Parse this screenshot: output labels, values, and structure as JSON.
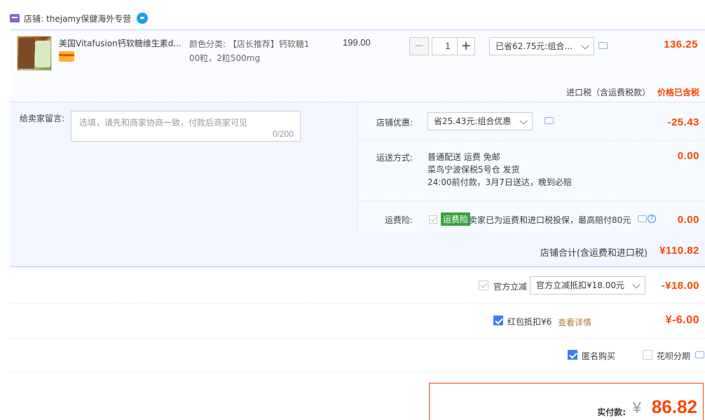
{
  "store": {
    "prefix": "店铺:",
    "name": "thejamy保健海外专营"
  },
  "item": {
    "title": "美国Vitafusion钙软糖维生素d...",
    "sku_line1": "颜色分类: 【店长推荐】钙软糖1",
    "sku_line2": "00粒，2粒500mg",
    "unit_price": "199.00",
    "quantity": "1",
    "qty_minus": "−",
    "qty_plus": "+",
    "promo_selected": "已省62.75元:组合...",
    "total": "136.25",
    "tax_label": "进口税（含运费税款）",
    "tax_status": "价格已含税"
  },
  "message": {
    "label": "给卖家留言:",
    "placeholder": "选填，请先和商家协商一致，付款后商家可见",
    "counter": "0/200"
  },
  "store_coupon": {
    "label": "店铺优惠:",
    "selected": "省25.43元:组合优惠",
    "amount": "-25.43"
  },
  "shipping": {
    "label": "运送方式:",
    "line1": "普通配送 运费 免邮",
    "line2": "菜鸟宁波保税5号仓   发货",
    "line3": "24:00前付款，3月7日送达，晚到必赔",
    "amount": "0.00"
  },
  "insurance": {
    "label": "运费险:",
    "badge": "运费险",
    "text": "卖家已为运费和进口税投保，最高赔付80元",
    "amount": "0.00"
  },
  "store_total": {
    "label": "店铺合计(含运费和进口税)",
    "amount": "¥110.82"
  },
  "official": {
    "label": "官方立减",
    "selected": "官方立减抵扣¥18.00元",
    "amount": "-¥18.00"
  },
  "redpacket": {
    "label": "红包抵扣¥6",
    "link": "查看详情",
    "amount": "¥-6.00"
  },
  "options": {
    "anonymous": "匿名购买",
    "huabei": "花呗分期"
  },
  "payment": {
    "label": "实付款:",
    "currency": "¥",
    "amount": "86.82"
  },
  "colors": {
    "accent": "#ff4400",
    "link_blue": "#3c7ff0",
    "insurance_green": "#3aa442"
  }
}
